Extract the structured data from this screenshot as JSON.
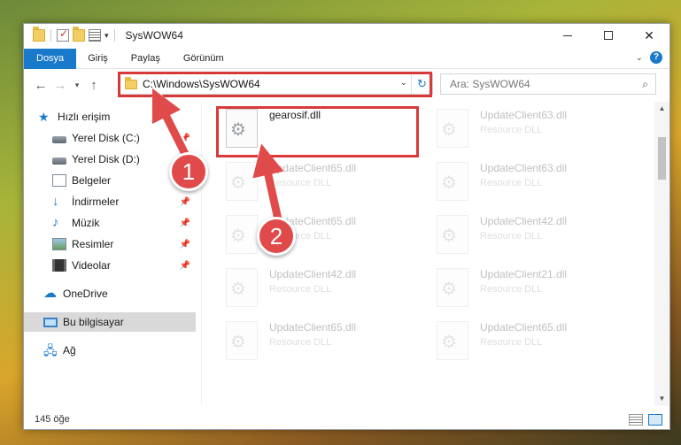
{
  "window": {
    "title": "SysWOW64",
    "buttons": {
      "minimize": "—",
      "maximize": "☐",
      "close": "✕"
    }
  },
  "ribbon": {
    "tabs": [
      "Dosya",
      "Giriş",
      "Paylaş",
      "Görünüm"
    ],
    "help": "?"
  },
  "address": {
    "path": "C:\\Windows\\SysWOW64",
    "search_placeholder": "Ara: SysWOW64"
  },
  "nav_pane": {
    "items": [
      {
        "label": "Hızlı erişim",
        "icon": "star-icon"
      },
      {
        "label": "Yerel Disk (C:)",
        "icon": "disk-icon",
        "pinned": true
      },
      {
        "label": "Yerel Disk (D:)",
        "icon": "disk-icon",
        "pinned": false
      },
      {
        "label": "Belgeler",
        "icon": "documents-icon"
      },
      {
        "label": "İndirmeler",
        "icon": "download-icon",
        "pinned": true
      },
      {
        "label": "Müzik",
        "icon": "music-icon",
        "pinned": true
      },
      {
        "label": "Resimler",
        "icon": "pictures-icon",
        "pinned": true
      },
      {
        "label": "Videolar",
        "icon": "videos-icon",
        "pinned": true
      },
      {
        "label": "OneDrive",
        "icon": "onedrive-icon"
      },
      {
        "label": "Bu bilgisayar",
        "icon": "this-pc-icon",
        "selected": true
      },
      {
        "label": "Ağ",
        "icon": "network-icon"
      }
    ]
  },
  "files": [
    {
      "name": "gearosif.dll",
      "type": "",
      "highlight": true
    },
    {
      "name": "UpdateClient63.dll",
      "type": "Resource DLL"
    },
    {
      "name": "UpdateClient65.dll",
      "type": "Resource DLL"
    },
    {
      "name": "UpdateClient63.dll",
      "type": "Resource DLL"
    },
    {
      "name": "UpdateClient65.dll",
      "type": "Resource DLL"
    },
    {
      "name": "UpdateClient42.dll",
      "type": "Resource DLL"
    },
    {
      "name": "UpdateClient42.dll",
      "type": "Resource DLL"
    },
    {
      "name": "UpdateClient21.dll",
      "type": "Resource DLL"
    },
    {
      "name": "UpdateClient65.dll",
      "type": "Resource DLL"
    },
    {
      "name": "UpdateClient65.dll",
      "type": "Resource DLL"
    }
  ],
  "status": {
    "count": "145 öğe"
  },
  "annotations": {
    "callout_1": "1",
    "callout_2": "2"
  },
  "colors": {
    "accent": "#1979ca",
    "highlight": "#d83a3a",
    "callout": "#e04a4a"
  }
}
